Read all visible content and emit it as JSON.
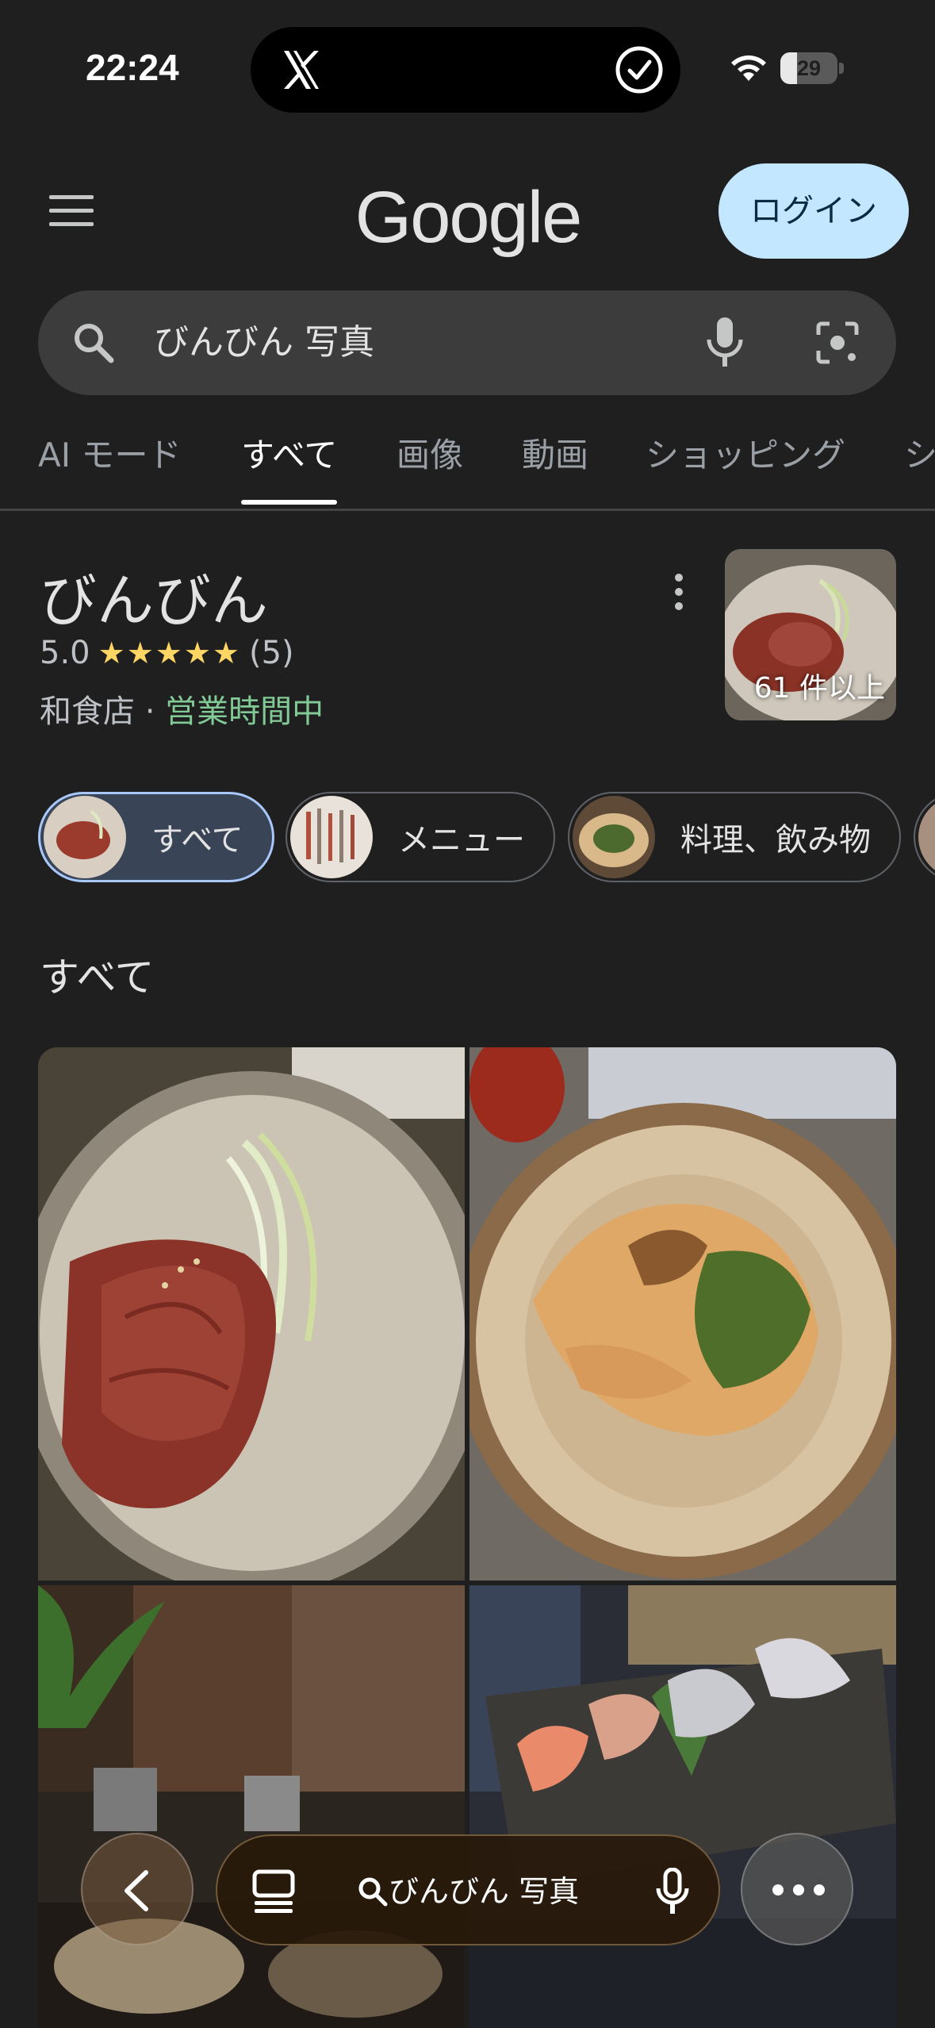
{
  "status_bar": {
    "time": "22:24",
    "battery": "29",
    "battery_level": 0.29
  },
  "header": {
    "logo": "Google",
    "login_label": "ログイン"
  },
  "search": {
    "query": "びんびん 写真"
  },
  "tabs": [
    {
      "label": "AI モード",
      "active": false
    },
    {
      "label": "すべて",
      "active": true
    },
    {
      "label": "画像",
      "active": false
    },
    {
      "label": "動画",
      "active": false
    },
    {
      "label": "ショッピング",
      "active": false
    },
    {
      "label": "シ",
      "active": false
    }
  ],
  "place": {
    "name": "びんびん",
    "rating": "5.0",
    "stars": "★★★★★",
    "review_count": "(5)",
    "category": "和食店 · ",
    "status": "営業時間中",
    "photo_count": "61 件以上"
  },
  "filter_chips": [
    {
      "label": "すべて",
      "active": true
    },
    {
      "label": "メニュー",
      "active": false
    },
    {
      "label": "料理、飲み物",
      "active": false
    }
  ],
  "section": {
    "heading": "すべて"
  },
  "bottom_bar": {
    "query": "びんびん 写真"
  },
  "icons": [
    "x-logo-icon",
    "verified-check-icon",
    "wifi-icon",
    "menu-icon",
    "search-icon",
    "mic-icon",
    "lens-camera-icon",
    "more-vert-icon",
    "back-chevron-icon",
    "tabs-icon",
    "more-horiz-icon"
  ],
  "colors": {
    "background": "#1f1f1f",
    "login_bg": "#c2e7ff",
    "star": "#fdd663",
    "open": "#81c995",
    "chip_active_border": "#a8c7fa"
  }
}
